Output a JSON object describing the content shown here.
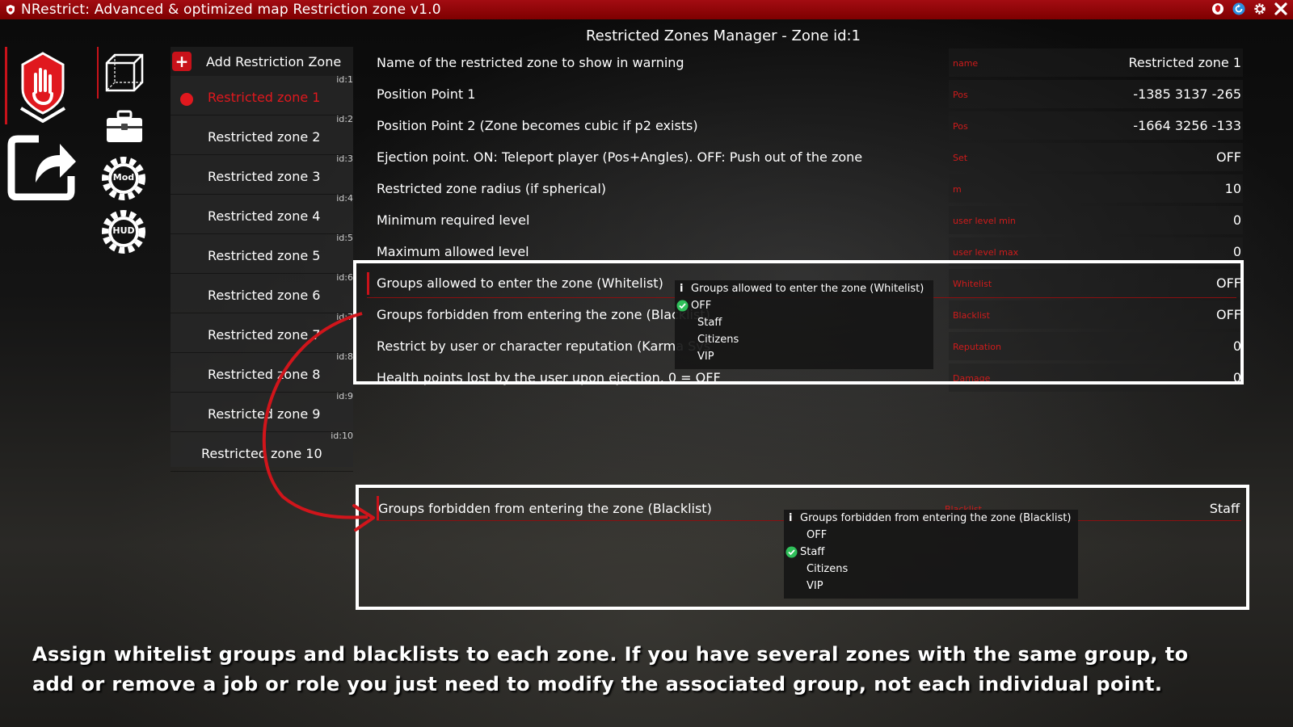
{
  "window": {
    "title": "NRestrict: Advanced & optimized map Restriction zone v1.0"
  },
  "titlebar_icons": [
    "shield-icon",
    "refresh-icon",
    "gear-icon",
    "close-icon"
  ],
  "sidebar": {
    "main_icons": [
      "hand-stop-icon",
      "share-icon"
    ],
    "category_icons": [
      "cube-icon",
      "briefcase-icon"
    ],
    "badges": [
      {
        "icon": "mod-gear-icon",
        "label": "Mod"
      },
      {
        "icon": "hud-gear-icon",
        "label": "HUD"
      }
    ]
  },
  "zone_list": {
    "add_label": "Add Restriction Zone",
    "zones": [
      {
        "label": "Restricted zone 1",
        "id": "id:1",
        "active": true
      },
      {
        "label": "Restricted zone 2",
        "id": "id:2"
      },
      {
        "label": "Restricted zone 3",
        "id": "id:3"
      },
      {
        "label": "Restricted zone 4",
        "id": "id:4"
      },
      {
        "label": "Restricted zone 5",
        "id": "id:5"
      },
      {
        "label": "Restricted zone 6",
        "id": "id:6"
      },
      {
        "label": "Restricted zone 7",
        "id": "id:7"
      },
      {
        "label": "Restricted zone 8",
        "id": "id:8"
      },
      {
        "label": "Restricted zone 9",
        "id": "id:9"
      },
      {
        "label": "Restricted zone 10",
        "id": "id:10"
      }
    ]
  },
  "manager": {
    "title": "Restricted Zones Manager - Zone id:1",
    "rows": [
      {
        "label": "Name of the restricted zone to show in warning",
        "unit": "name",
        "value": "Restricted zone 1"
      },
      {
        "label": "Position Point 1",
        "unit": "Pos",
        "value": "-1385 3137 -265"
      },
      {
        "label": "Position Point 2 (Zone becomes cubic if p2 exists)",
        "unit": "Pos",
        "value": "-1664 3256 -133"
      },
      {
        "label": "Ejection point. ON: Teleport player (Pos+Angles). OFF: Push out of the zone",
        "unit": "Set",
        "value": "OFF"
      },
      {
        "label": "Restricted zone radius (if spherical)",
        "unit": "m",
        "value": "10"
      },
      {
        "label": "Minimum required level",
        "unit": "user level min",
        "value": "0"
      },
      {
        "label": "Maximum allowed level",
        "unit": "user level max",
        "value": "0"
      },
      {
        "label": "Groups allowed to enter the zone (Whitelist)",
        "unit": "Whitelist",
        "value": "OFF"
      },
      {
        "label": "Groups forbidden from entering the zone (Blacklist)",
        "unit": "Blacklist",
        "value": "OFF"
      },
      {
        "label": "Restrict by user or character reputation (Karma Sys",
        "unit": "Reputation",
        "value": "0"
      },
      {
        "label": "Health points lost by the user upon ejection. 0 = OFF",
        "unit": "Damage",
        "value": "0"
      }
    ]
  },
  "whitelist_dropdown": {
    "header": "Groups allowed to enter the zone (Whitelist)",
    "options": [
      "OFF",
      "Staff",
      "Citizens",
      "VIP"
    ],
    "selected": "OFF"
  },
  "blacklist_panel": {
    "label": "Groups forbidden from entering the zone (Blacklist)",
    "unit": "Blacklist",
    "value": "Staff",
    "dropdown": {
      "header": "Groups forbidden from entering the zone (Blacklist)",
      "options": [
        "OFF",
        "Staff",
        "Citizens",
        "VIP"
      ],
      "selected": "Staff"
    }
  },
  "caption": {
    "line1": "Assign whitelist groups and blacklists to each zone. If you have several zones with the same group, to",
    "line2": "add or remove a job or role you just need to modify the associated group, not each individual point."
  },
  "colors": {
    "accent": "#c8121a",
    "titlebar": "#8b0000",
    "highlight_box": "#ffffff",
    "check": "#2fbf5a"
  }
}
